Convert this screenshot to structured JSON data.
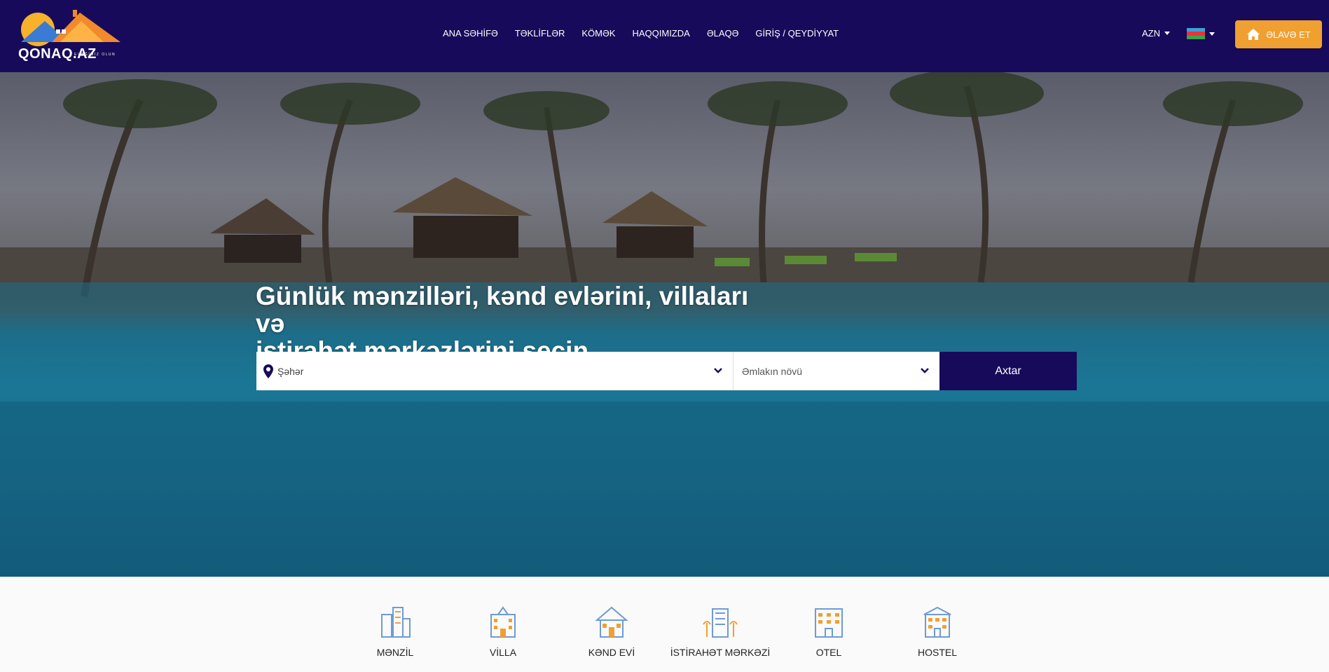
{
  "brand": {
    "name": "QONAQ.AZ",
    "tagline": "EVƏĞİMİZ OLUN"
  },
  "nav": {
    "items": [
      "ANA SƏHİFƏ",
      "TƏKLİFLƏR",
      "KÖMƏK",
      "HAQQIMIZDA",
      "ƏLAQƏ",
      "GİRİŞ / QEYDİYYAT"
    ]
  },
  "header": {
    "currency": "AZN",
    "language_flag": "azerbaijan-flag",
    "add_button": "ƏLAVƏ ET"
  },
  "hero": {
    "title_line1": "Günlük mənzilləri, kənd evlərini, villaları və",
    "title_line2": "istirahət mərkəzlərini seçin"
  },
  "search": {
    "city_placeholder": "Şəhər",
    "type_placeholder": "Əmlakın növü",
    "button": "Axtar"
  },
  "categories": [
    {
      "label": "MƏNZİL",
      "icon": "apartment-icon"
    },
    {
      "label": "VİLLA",
      "icon": "villa-icon"
    },
    {
      "label": "KƏND EVİ",
      "icon": "village-house-icon"
    },
    {
      "label": "İSTİRAHƏT MƏRKƏZİ",
      "icon": "resort-icon"
    },
    {
      "label": "OTEL",
      "icon": "hotel-icon"
    },
    {
      "label": "HOSTEL",
      "icon": "hostel-icon"
    }
  ],
  "colors": {
    "header_bg": "#180a5a",
    "accent": "#f0a030",
    "search_button": "#180a5a"
  }
}
